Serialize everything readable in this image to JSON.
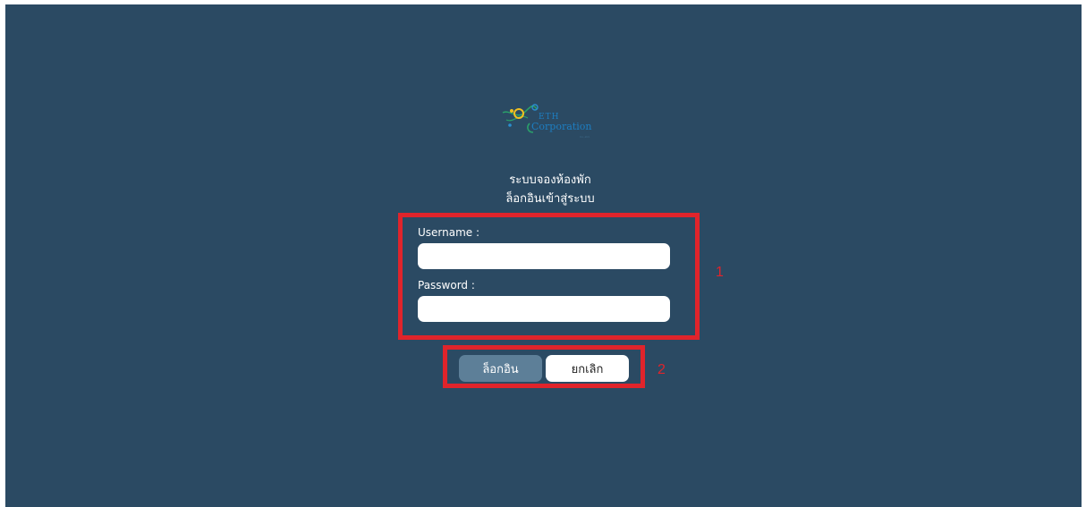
{
  "logo": {
    "line1": "ETH",
    "line2": "Corporation",
    "sub": "Co.,Ltd."
  },
  "header": {
    "title": "ระบบจองห้องพัก",
    "subtitle": "ล็อกอินเข้าสู่ระบบ"
  },
  "form": {
    "username_label": "Username :",
    "username_value": "",
    "password_label": "Password :",
    "password_value": ""
  },
  "buttons": {
    "login_label": "ล็อกอิน",
    "cancel_label": "ยกเลิก"
  },
  "annotations": {
    "marker_1": "1",
    "marker_2": "2"
  },
  "colors": {
    "background": "#2b4a63",
    "login_button": "#5d7f98",
    "annotation": "#e0242b"
  }
}
